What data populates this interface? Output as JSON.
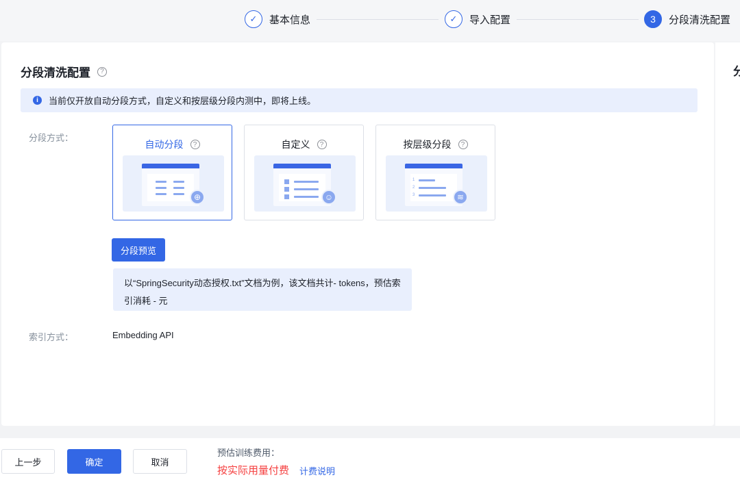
{
  "steps": [
    {
      "label": "基本信息",
      "marker": "✓"
    },
    {
      "label": "导入配置",
      "marker": "✓"
    },
    {
      "label": "分段清洗配置",
      "marker": "3"
    }
  ],
  "card": {
    "title": "分段清洗配置",
    "info": "当前仅开放自动分段方式，自定义和按层级分段内测中，即将上线。",
    "segment_label": "分段方式：",
    "options": [
      {
        "label": "自动分段",
        "selected": true
      },
      {
        "label": "自定义",
        "selected": false
      },
      {
        "label": "按层级分段",
        "selected": false
      }
    ],
    "preview_button": "分段预览",
    "preview_note": "以“SpringSecurity动态授权.txt”文档为例，该文档共计- tokens，预估索引消耗 - 元",
    "index_label": "索引方式：",
    "index_value": "Embedding API"
  },
  "right_peek": "分",
  "footer": {
    "prev": "上一步",
    "confirm": "确定",
    "cancel": "取消",
    "fee_label": "预估训练费用：",
    "fee_value": "按实际用量付费",
    "fee_link": "计费说明"
  },
  "colors": {
    "accent": "#3367e5",
    "fee": "#f53f3f",
    "info_bg": "#e9effd"
  }
}
